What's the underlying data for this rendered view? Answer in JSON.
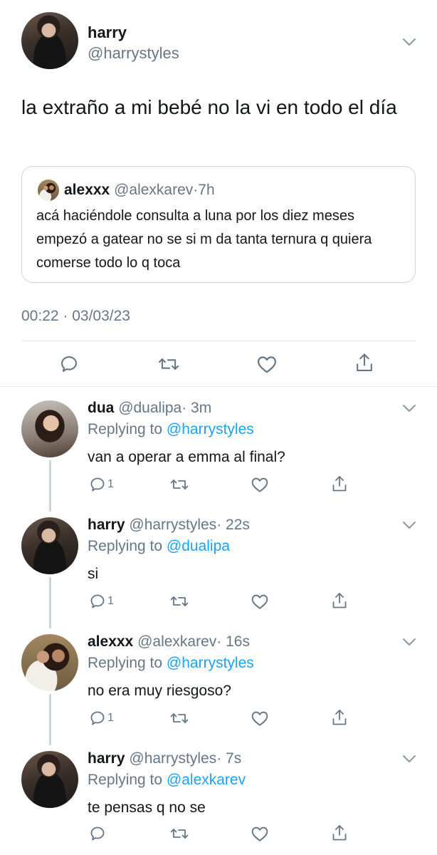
{
  "main_tweet": {
    "name": "harry",
    "handle": "@harrystyles",
    "text": "la extraño a mi bebé no la vi en todo el día",
    "quote": {
      "name": "alexxx",
      "handle": "@alexkarev",
      "time": "·7h",
      "text": "acá haciéndole consulta a luna por los diez meses empezó a gatear no se si m da tanta ternura q quiera comerse todo lo q toca"
    },
    "timestamp": "00:22 · 03/03/23"
  },
  "replies": [
    {
      "name": "dua",
      "handle": "@dualipa",
      "time": "· 3m",
      "replying_prefix": "Replying to ",
      "replying_to": "@harrystyles",
      "text": "van a operar a emma al final?",
      "reply_count": "1"
    },
    {
      "name": "harry",
      "handle": "@harrystyles",
      "time": "· 22s",
      "replying_prefix": "Replying to ",
      "replying_to": "@dualipa",
      "text": "si",
      "reply_count": "1"
    },
    {
      "name": "alexxx",
      "handle": "@alexkarev",
      "time": "· 16s",
      "replying_prefix": "Replying to ",
      "replying_to": "@harrystyles",
      "text": "no era muy riesgoso?",
      "reply_count": "1"
    },
    {
      "name": "harry",
      "handle": "@harrystyles",
      "time": "· 7s",
      "replying_prefix": "Replying to ",
      "replying_to": "@alexkarev",
      "text": "te pensas q no se",
      "reply_count": ""
    }
  ],
  "icons": {
    "reply": "reply-icon",
    "retweet": "retweet-icon",
    "like": "heart-icon",
    "share": "share-icon",
    "menu": "chevron-down-icon"
  },
  "colors": {
    "text": "#14171a",
    "secondary": "#657786",
    "link": "#1da1f2",
    "border": "#ccd6dd"
  }
}
